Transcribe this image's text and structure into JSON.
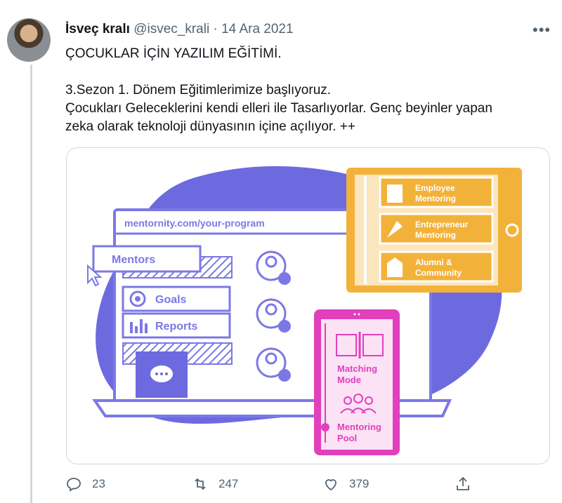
{
  "tweet": {
    "author_name": "İsveç kralı",
    "handle": "@isvec_krali",
    "separator": "·",
    "date": "14 Ara 2021",
    "more_label": "•••",
    "lines": [
      "ÇOCUKLAR İÇİN YAZILIM EĞİTİMİ.",
      "3.Sezon 1. Dönem Eğitimlerimize başlıyoruz.",
      "Çocukları Geleceklerini kendi elleri ile Tasarlıyorlar. Genç beyinler yapan",
      "zeka olarak teknoloji dünyasının içine açılıyor. ++"
    ]
  },
  "image": {
    "url_bar": "mentornity.com/your-program",
    "menu": {
      "mentors": "Mentors",
      "goals": "Goals",
      "reports": "Reports"
    },
    "programs": {
      "employee": [
        "Employee",
        "Mentoring"
      ],
      "entrepreneur": [
        "Entrepreneur",
        "Mentoring"
      ],
      "alumni": [
        "Alumni &",
        "Community"
      ]
    },
    "phone": {
      "matching": [
        "Matching",
        "Mode"
      ],
      "pool": [
        "Mentoring",
        "Pool"
      ]
    },
    "colors": {
      "purple": "#7b78e6",
      "purple_light": "#d9d7f5",
      "orange": "#f2b23a",
      "pink": "#e23fbd",
      "pink_light": "#fbe2f5",
      "blob": "#6d6ae0"
    }
  },
  "actions": {
    "reply_count": "23",
    "retweet_count": "247",
    "like_count": "379"
  }
}
